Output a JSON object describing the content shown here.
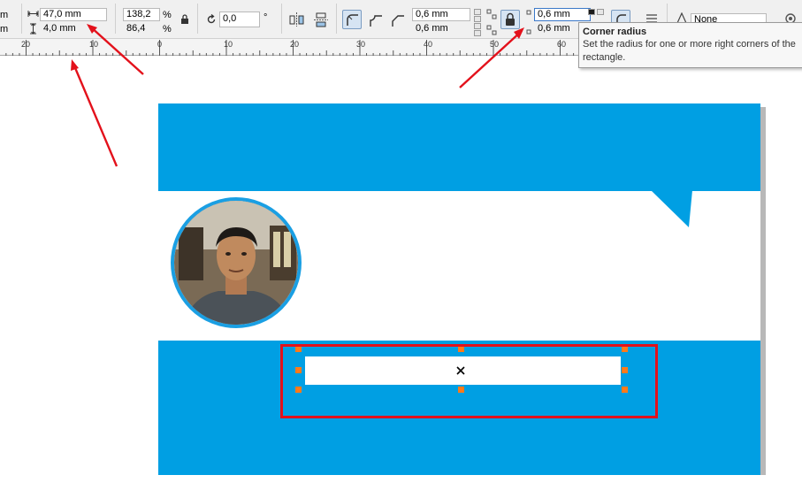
{
  "toolbar": {
    "left_unit_top": "m",
    "left_unit_bottom": "m",
    "width_value": "47,0 mm",
    "height_value": "4,0 mm",
    "scale_x": "138,2",
    "scale_y": "86,4",
    "percent": "%",
    "rotation_value": "0,0",
    "degree": "°",
    "corner_radius_left_top": "0,6 mm",
    "corner_radius_left_bottom": "0,6 mm",
    "corner_radius_right_top": "0,6 mm",
    "corner_radius_right_bottom": "0,6 mm",
    "outline_style": "None"
  },
  "ruler": {
    "labels": [
      "20",
      "10",
      "0",
      "10",
      "20",
      "30",
      "40",
      "50",
      "60"
    ]
  },
  "tooltip": {
    "title": "Corner radius",
    "body": "Set the radius for one or more right corners of the rectangle."
  },
  "design": {
    "band_color": "#009fe3",
    "accent_color": "#1a9fe3",
    "selection_frame_color": "#e3111b",
    "handle_color": "#ff7a1a",
    "arrow_color": "#e3111b"
  }
}
